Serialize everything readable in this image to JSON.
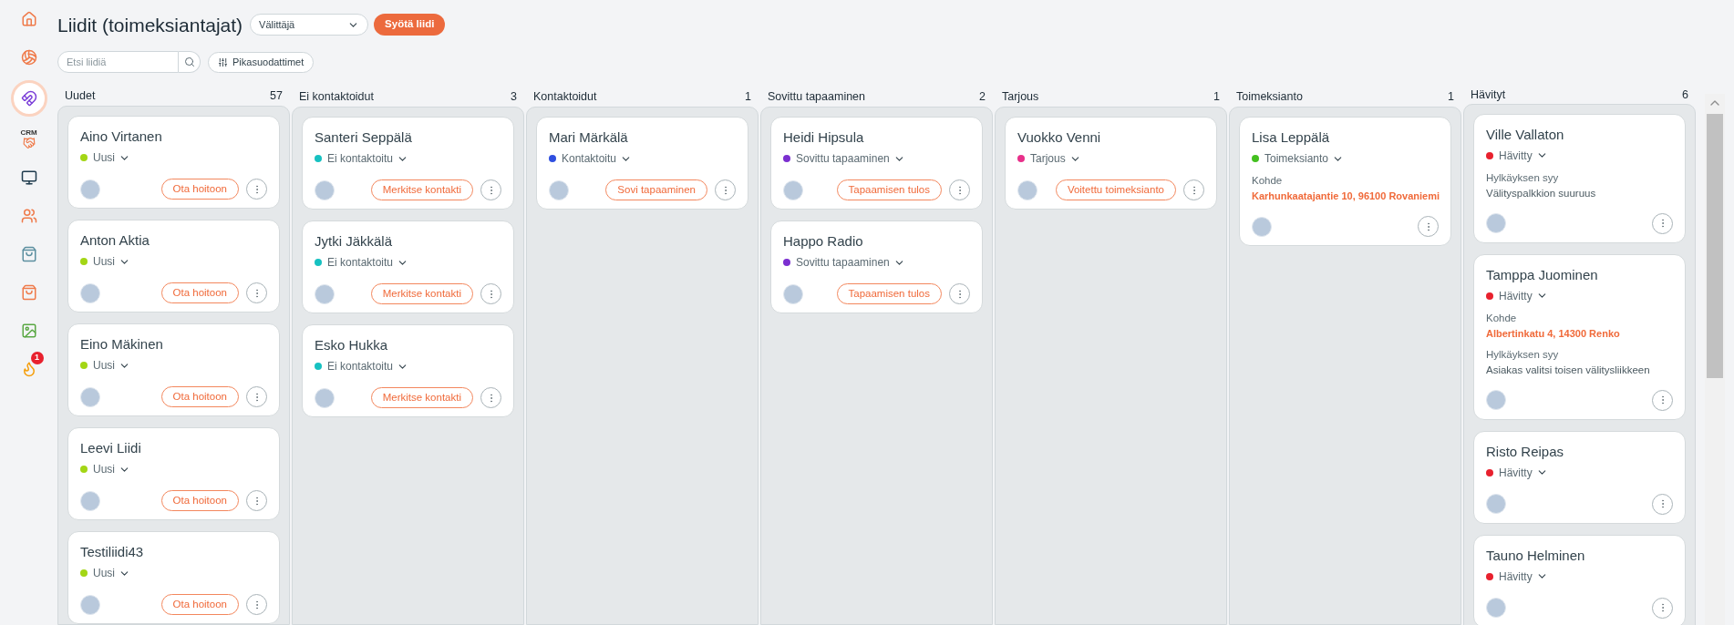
{
  "sidebar": {
    "items": [
      {
        "selected": false
      },
      {
        "selected": false
      },
      {
        "selected": true
      },
      {
        "selected": false,
        "label": "CRM"
      },
      {
        "selected": false
      },
      {
        "selected": false
      },
      {
        "selected": false
      },
      {
        "selected": false
      },
      {
        "selected": false
      },
      {
        "selected": false,
        "badge": "1"
      }
    ]
  },
  "header": {
    "title": "Liidit (toimeksiantajat)",
    "dealer_select": {
      "value": "Välittäjä"
    },
    "add_button": "Syötä liidi"
  },
  "toolbar": {
    "search": {
      "placeholder": "Etsi liidiä"
    },
    "filter_button": "Pikasuodattimet"
  },
  "columns": [
    {
      "title": "Uudet",
      "count": "57",
      "cards": [
        {
          "name": "Aino Virtanen",
          "status": "Uusi",
          "color": "#a3d615",
          "action": "Ota hoitoon"
        },
        {
          "name": "Anton Aktia",
          "status": "Uusi",
          "color": "#a3d615",
          "action": "Ota hoitoon"
        },
        {
          "name": "Eino Mäkinen",
          "status": "Uusi",
          "color": "#a3d615",
          "action": "Ota hoitoon"
        },
        {
          "name": "Leevi Liidi",
          "status": "Uusi",
          "color": "#a3d615",
          "action": "Ota hoitoon"
        },
        {
          "name": "Testiliidi43",
          "status": "Uusi",
          "color": "#a3d615",
          "action": "Ota hoitoon"
        }
      ]
    },
    {
      "title": "Ei kontaktoidut",
      "count": "3",
      "cards": [
        {
          "name": "Santeri Seppälä",
          "status": "Ei kontaktoitu",
          "color": "#17c1c1",
          "action": "Merkitse kontakti"
        },
        {
          "name": "Jytki Jäkkälä",
          "status": "Ei kontaktoitu",
          "color": "#17c1c1",
          "action": "Merkitse kontakti"
        },
        {
          "name": "Esko Hukka",
          "status": "Ei kontaktoitu",
          "color": "#17c1c1",
          "action": "Merkitse kontakti"
        }
      ]
    },
    {
      "title": "Kontaktoidut",
      "count": "1",
      "cards": [
        {
          "name": "Mari Märkälä",
          "status": "Kontaktoitu",
          "color": "#2f4fe0",
          "action": "Sovi tapaaminen"
        }
      ]
    },
    {
      "title": "Sovittu tapaaminen",
      "count": "2",
      "cards": [
        {
          "name": "Heidi Hipsula",
          "status": "Sovittu tapaaminen",
          "color": "#7b2fd0",
          "action": "Tapaamisen tulos"
        },
        {
          "name": "Happo Radio",
          "status": "Sovittu tapaaminen",
          "color": "#7b2fd0",
          "action": "Tapaamisen tulos"
        }
      ]
    },
    {
      "title": "Tarjous",
      "count": "1",
      "cards": [
        {
          "name": "Vuokko Venni",
          "status": "Tarjous",
          "color": "#e8308a",
          "action": "Voitettu toimeksianto"
        }
      ]
    },
    {
      "title": "Toimeksianto",
      "count": "1",
      "cards": [
        {
          "name": "Lisa Leppälä",
          "status": "Toimeksianto",
          "color": "#44c020",
          "fields": [
            {
              "label": "Kohde",
              "value": "Karhunkaatajantie 10, 96100 Rovaniemi",
              "kind": "address"
            }
          ]
        }
      ]
    },
    {
      "title": "Hävityt",
      "count": "6",
      "cards": [
        {
          "name": "Ville Vallaton",
          "status": "Hävitty",
          "color": "#e8212e",
          "fields": [
            {
              "label": "Hylkäyksen syy",
              "value": "Välityspalkkion suuruus",
              "kind": "text"
            }
          ]
        },
        {
          "name": "Tamppa Juominen",
          "status": "Hävitty",
          "color": "#e8212e",
          "fields": [
            {
              "label": "Kohde",
              "value": "Albertinkatu 4, 14300 Renko",
              "kind": "address"
            },
            {
              "label": "Hylkäyksen syy",
              "value": "Asiakas valitsi toisen välitysliikkeen",
              "kind": "text"
            }
          ]
        },
        {
          "name": "Risto Reipas",
          "status": "Hävitty",
          "color": "#e8212e"
        },
        {
          "name": "Tauno Helminen",
          "status": "Hävitty",
          "color": "#e8212e"
        }
      ]
    }
  ]
}
